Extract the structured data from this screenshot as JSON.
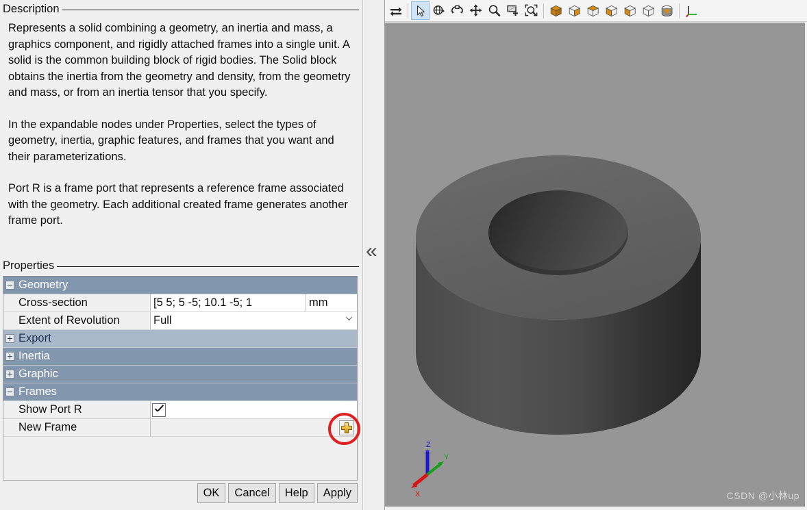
{
  "dialog": {
    "description": {
      "group_label": "Description",
      "paragraphs": [
        "Represents a solid combining a geometry, an inertia and mass, a graphics component, and rigidly attached frames into a single unit. A solid is the common building block of rigid bodies. The Solid block obtains the inertia from the geometry and density, from the geometry and mass, or from an inertia tensor that you specify.",
        "In the expandable nodes under Properties, select the types of geometry, inertia, graphic features, and frames that you want and their parameterizations.",
        "Port R is a frame port that represents a reference frame associated with the geometry. Each additional created frame generates another frame port."
      ]
    },
    "properties": {
      "group_label": "Properties",
      "rows": [
        {
          "kind": "node-top",
          "label": "Geometry",
          "state": "expanded"
        },
        {
          "kind": "leaf",
          "label": "Cross-section",
          "value": "[5 5; 5 -5; 10.1 -5; 1",
          "unit": "mm",
          "control": "value-unit-combo"
        },
        {
          "kind": "leaf",
          "label": "Extent of Revolution",
          "value": "Full",
          "control": "combo"
        },
        {
          "kind": "node-sub",
          "label": "Export",
          "state": "collapsed"
        },
        {
          "kind": "node-top",
          "label": "Inertia",
          "state": "collapsed"
        },
        {
          "kind": "node-top",
          "label": "Graphic",
          "state": "collapsed"
        },
        {
          "kind": "node-top",
          "label": "Frames",
          "state": "expanded"
        },
        {
          "kind": "leaf",
          "label": "Show Port R",
          "value": "checked",
          "control": "checkbox"
        },
        {
          "kind": "leaf",
          "label": "New Frame",
          "value": "",
          "control": "add-button"
        }
      ]
    },
    "buttons": [
      {
        "label": "OK",
        "name": "ok-button"
      },
      {
        "label": "Cancel",
        "name": "cancel-button"
      },
      {
        "label": "Help",
        "name": "help-button"
      },
      {
        "label": "Apply",
        "name": "apply-button"
      }
    ]
  },
  "splitter": {
    "collapse_glyph": "«"
  },
  "viewer": {
    "toolbar": [
      {
        "icon": "swap-arrows-icon",
        "active": false,
        "group": 0
      },
      {
        "icon": "separator",
        "active": false,
        "group": 0
      },
      {
        "icon": "cursor-select-icon",
        "active": true,
        "group": 1
      },
      {
        "icon": "rotate-view-icon",
        "active": false,
        "group": 1
      },
      {
        "icon": "orbit-icon",
        "active": false,
        "group": 1
      },
      {
        "icon": "pan-move-icon",
        "active": false,
        "group": 1
      },
      {
        "icon": "zoom-magnifier-icon",
        "active": false,
        "group": 1
      },
      {
        "icon": "zoom-window-icon",
        "active": false,
        "group": 1
      },
      {
        "icon": "zoom-fit-icon",
        "active": false,
        "group": 1
      },
      {
        "icon": "separator",
        "active": false,
        "group": 1
      },
      {
        "icon": "view-iso-icon",
        "active": false,
        "group": 2
      },
      {
        "icon": "view-front-icon",
        "active": false,
        "group": 2
      },
      {
        "icon": "view-top-icon",
        "active": false,
        "group": 2
      },
      {
        "icon": "view-bottom-icon",
        "active": false,
        "group": 2
      },
      {
        "icon": "view-left-icon",
        "active": false,
        "group": 2
      },
      {
        "icon": "view-right-icon",
        "active": false,
        "group": 2
      },
      {
        "icon": "view-rear-icon",
        "active": false,
        "group": 2
      },
      {
        "icon": "separator",
        "active": false,
        "group": 2
      },
      {
        "icon": "show-axes-icon",
        "active": false,
        "group": 3
      }
    ],
    "axis_triad": {
      "x_label": "X",
      "x_color": "#d91414",
      "y_label": "Y",
      "y_color": "#16a016",
      "z_label": "Z",
      "z_color": "#1a1ad0"
    },
    "scene": {
      "shape": "hollow-cylinder",
      "background": "#969696",
      "top_face_color": "#646464",
      "side_face_color": "#3d3d3d",
      "bore_color": "#303030"
    },
    "watermark": "CSDN @小林up"
  }
}
